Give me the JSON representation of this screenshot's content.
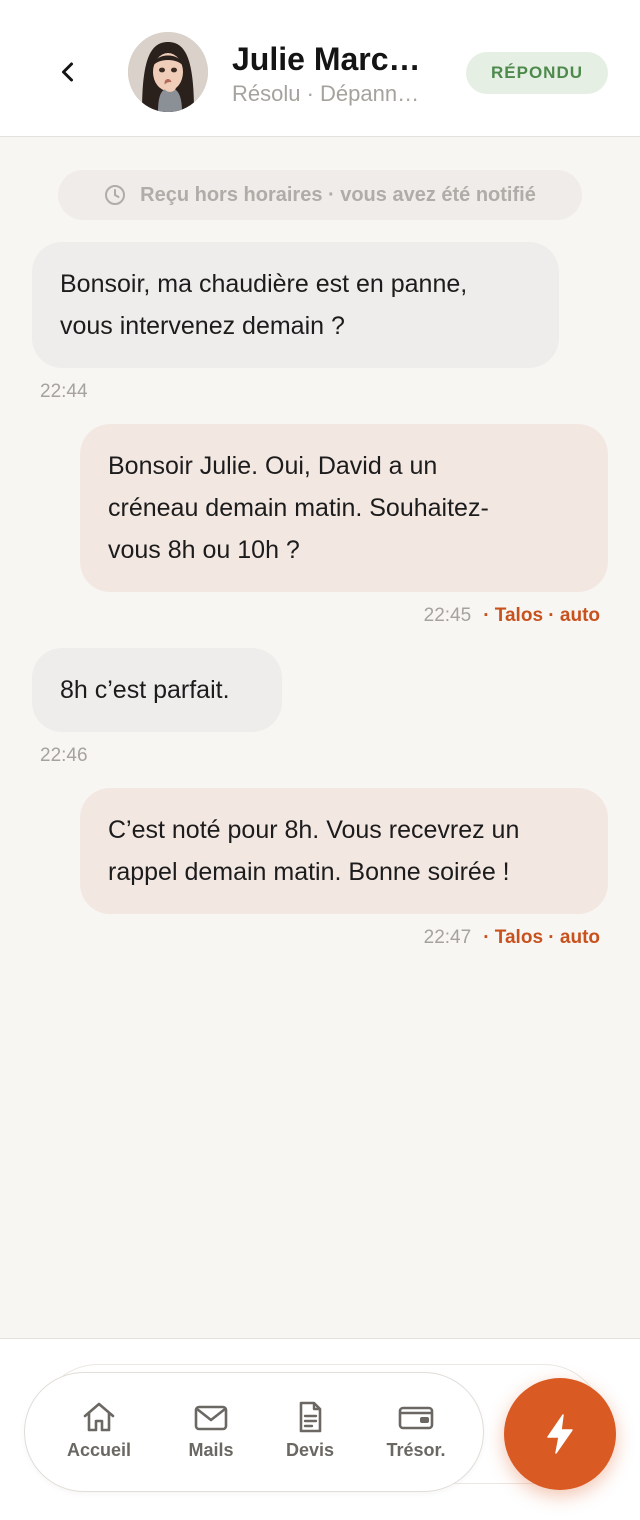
{
  "header": {
    "contact_name": "Julie Marc…",
    "subtitle": "Résolu · Dépann…",
    "status": "RÉPONDU"
  },
  "notice": {
    "text": "Reçu hors horaires · vous avez été notifié"
  },
  "messages": [
    {
      "direction": "in",
      "lines": [
        "Bonsoir, ma chaudière est en panne,",
        "vous intervenez demain ?"
      ],
      "time": "22:44"
    },
    {
      "direction": "out",
      "lines": [
        "Bonsoir Julie. Oui, David a un",
        "créneau demain matin. Souhaitez-",
        "vous 8h ou 10h ?"
      ],
      "time": "22:45",
      "tag": "· Talos · auto"
    },
    {
      "direction": "in",
      "lines": [
        "8h c’est parfait."
      ],
      "time": "22:46"
    },
    {
      "direction": "out",
      "lines": [
        "C’est noté pour 8h. Vous recevrez un",
        "rappel demain matin. Bonne soirée !"
      ],
      "time": "22:47",
      "tag": "· Talos · auto"
    }
  ],
  "nav": {
    "items": [
      {
        "label": "Accueil",
        "icon": "home-icon"
      },
      {
        "label": "Mails",
        "icon": "mail-icon"
      },
      {
        "label": "Devis",
        "icon": "document-icon"
      },
      {
        "label": "Trésor.",
        "icon": "wallet-icon"
      }
    ],
    "fab_icon": "lightning-icon"
  },
  "colors": {
    "accent": "#d95a22",
    "status_green": "#4f8a4d",
    "incoming_bubble": "#eeedeb",
    "outgoing_bubble": "#f3e7e2"
  }
}
